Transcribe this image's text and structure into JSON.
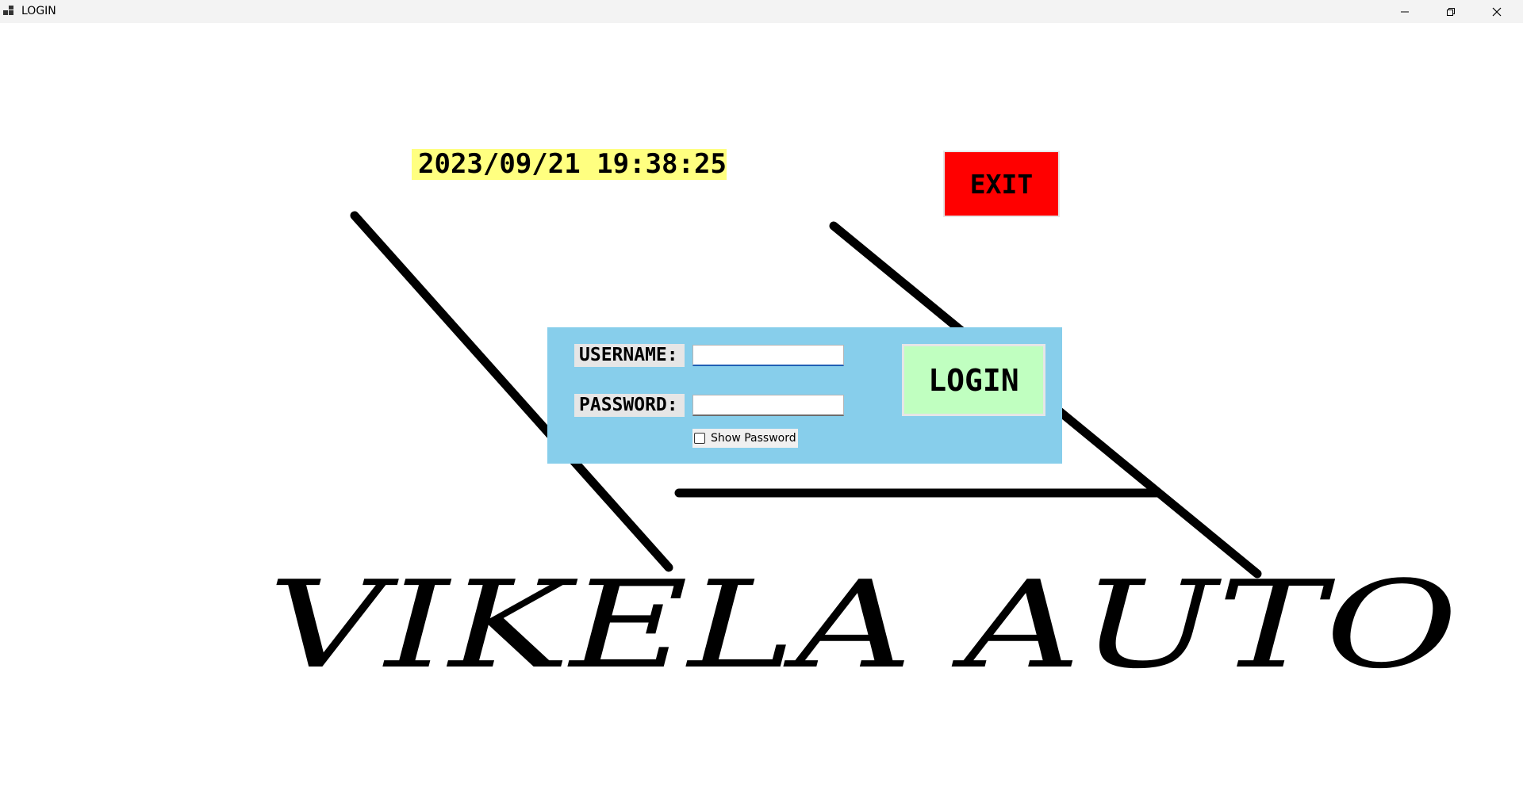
{
  "window": {
    "title": "LOGIN",
    "controls": {
      "minimize": "minimize-icon",
      "restore": "restore-icon",
      "close": "close-icon"
    }
  },
  "header": {
    "datetime": "2023/09/21 19:38:25",
    "exit_label": "EXIT"
  },
  "login_form": {
    "username_label": "USERNAME:",
    "username_value": "",
    "password_label": "PASSWORD:",
    "password_value": "",
    "show_password_label": "Show Password",
    "show_password_checked": false,
    "login_label": "LOGIN"
  },
  "logo": {
    "text": "VIKELA AUTO"
  },
  "colors": {
    "datetime_bg": "#ffff80",
    "exit_bg": "#ff0000",
    "panel_bg": "#87ceeb",
    "login_bg": "#c0ffc0"
  }
}
